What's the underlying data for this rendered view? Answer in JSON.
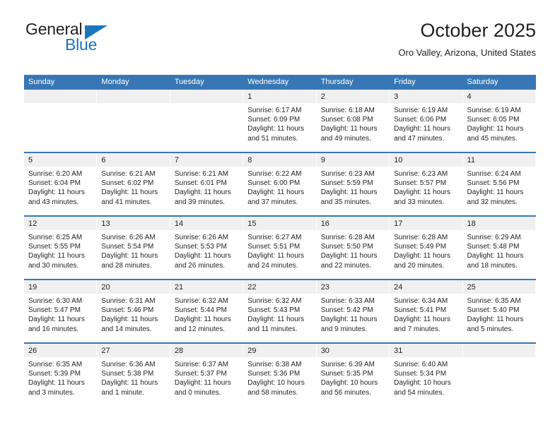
{
  "brand": {
    "name_top": "General",
    "name_bottom": "Blue",
    "logo_color": "#1b75bb",
    "triangle_icon": "triangle-icon"
  },
  "header": {
    "month_title": "October 2025",
    "location": "Oro Valley, Arizona, United States"
  },
  "theme": {
    "header_blue": "#3877b5",
    "daynum_band": "#f0f0f0",
    "text": "#231f20"
  },
  "calendar": {
    "weekday_headers": [
      "Sunday",
      "Monday",
      "Tuesday",
      "Wednesday",
      "Thursday",
      "Friday",
      "Saturday"
    ],
    "weeks": [
      [
        {
          "day": "",
          "lines": []
        },
        {
          "day": "",
          "lines": []
        },
        {
          "day": "",
          "lines": []
        },
        {
          "day": "1",
          "lines": [
            "Sunrise: 6:17 AM",
            "Sunset: 6:09 PM",
            "Daylight: 11 hours",
            "and 51 minutes."
          ]
        },
        {
          "day": "2",
          "lines": [
            "Sunrise: 6:18 AM",
            "Sunset: 6:08 PM",
            "Daylight: 11 hours",
            "and 49 minutes."
          ]
        },
        {
          "day": "3",
          "lines": [
            "Sunrise: 6:19 AM",
            "Sunset: 6:06 PM",
            "Daylight: 11 hours",
            "and 47 minutes."
          ]
        },
        {
          "day": "4",
          "lines": [
            "Sunrise: 6:19 AM",
            "Sunset: 6:05 PM",
            "Daylight: 11 hours",
            "and 45 minutes."
          ]
        }
      ],
      [
        {
          "day": "5",
          "lines": [
            "Sunrise: 6:20 AM",
            "Sunset: 6:04 PM",
            "Daylight: 11 hours",
            "and 43 minutes."
          ]
        },
        {
          "day": "6",
          "lines": [
            "Sunrise: 6:21 AM",
            "Sunset: 6:02 PM",
            "Daylight: 11 hours",
            "and 41 minutes."
          ]
        },
        {
          "day": "7",
          "lines": [
            "Sunrise: 6:21 AM",
            "Sunset: 6:01 PM",
            "Daylight: 11 hours",
            "and 39 minutes."
          ]
        },
        {
          "day": "8",
          "lines": [
            "Sunrise: 6:22 AM",
            "Sunset: 6:00 PM",
            "Daylight: 11 hours",
            "and 37 minutes."
          ]
        },
        {
          "day": "9",
          "lines": [
            "Sunrise: 6:23 AM",
            "Sunset: 5:59 PM",
            "Daylight: 11 hours",
            "and 35 minutes."
          ]
        },
        {
          "day": "10",
          "lines": [
            "Sunrise: 6:23 AM",
            "Sunset: 5:57 PM",
            "Daylight: 11 hours",
            "and 33 minutes."
          ]
        },
        {
          "day": "11",
          "lines": [
            "Sunrise: 6:24 AM",
            "Sunset: 5:56 PM",
            "Daylight: 11 hours",
            "and 32 minutes."
          ]
        }
      ],
      [
        {
          "day": "12",
          "lines": [
            "Sunrise: 6:25 AM",
            "Sunset: 5:55 PM",
            "Daylight: 11 hours",
            "and 30 minutes."
          ]
        },
        {
          "day": "13",
          "lines": [
            "Sunrise: 6:26 AM",
            "Sunset: 5:54 PM",
            "Daylight: 11 hours",
            "and 28 minutes."
          ]
        },
        {
          "day": "14",
          "lines": [
            "Sunrise: 6:26 AM",
            "Sunset: 5:53 PM",
            "Daylight: 11 hours",
            "and 26 minutes."
          ]
        },
        {
          "day": "15",
          "lines": [
            "Sunrise: 6:27 AM",
            "Sunset: 5:51 PM",
            "Daylight: 11 hours",
            "and 24 minutes."
          ]
        },
        {
          "day": "16",
          "lines": [
            "Sunrise: 6:28 AM",
            "Sunset: 5:50 PM",
            "Daylight: 11 hours",
            "and 22 minutes."
          ]
        },
        {
          "day": "17",
          "lines": [
            "Sunrise: 6:28 AM",
            "Sunset: 5:49 PM",
            "Daylight: 11 hours",
            "and 20 minutes."
          ]
        },
        {
          "day": "18",
          "lines": [
            "Sunrise: 6:29 AM",
            "Sunset: 5:48 PM",
            "Daylight: 11 hours",
            "and 18 minutes."
          ]
        }
      ],
      [
        {
          "day": "19",
          "lines": [
            "Sunrise: 6:30 AM",
            "Sunset: 5:47 PM",
            "Daylight: 11 hours",
            "and 16 minutes."
          ]
        },
        {
          "day": "20",
          "lines": [
            "Sunrise: 6:31 AM",
            "Sunset: 5:46 PM",
            "Daylight: 11 hours",
            "and 14 minutes."
          ]
        },
        {
          "day": "21",
          "lines": [
            "Sunrise: 6:32 AM",
            "Sunset: 5:44 PM",
            "Daylight: 11 hours",
            "and 12 minutes."
          ]
        },
        {
          "day": "22",
          "lines": [
            "Sunrise: 6:32 AM",
            "Sunset: 5:43 PM",
            "Daylight: 11 hours",
            "and 11 minutes."
          ]
        },
        {
          "day": "23",
          "lines": [
            "Sunrise: 6:33 AM",
            "Sunset: 5:42 PM",
            "Daylight: 11 hours",
            "and 9 minutes."
          ]
        },
        {
          "day": "24",
          "lines": [
            "Sunrise: 6:34 AM",
            "Sunset: 5:41 PM",
            "Daylight: 11 hours",
            "and 7 minutes."
          ]
        },
        {
          "day": "25",
          "lines": [
            "Sunrise: 6:35 AM",
            "Sunset: 5:40 PM",
            "Daylight: 11 hours",
            "and 5 minutes."
          ]
        }
      ],
      [
        {
          "day": "26",
          "lines": [
            "Sunrise: 6:35 AM",
            "Sunset: 5:39 PM",
            "Daylight: 11 hours",
            "and 3 minutes."
          ]
        },
        {
          "day": "27",
          "lines": [
            "Sunrise: 6:36 AM",
            "Sunset: 5:38 PM",
            "Daylight: 11 hours",
            "and 1 minute."
          ]
        },
        {
          "day": "28",
          "lines": [
            "Sunrise: 6:37 AM",
            "Sunset: 5:37 PM",
            "Daylight: 11 hours",
            "and 0 minutes."
          ]
        },
        {
          "day": "29",
          "lines": [
            "Sunrise: 6:38 AM",
            "Sunset: 5:36 PM",
            "Daylight: 10 hours",
            "and 58 minutes."
          ]
        },
        {
          "day": "30",
          "lines": [
            "Sunrise: 6:39 AM",
            "Sunset: 5:35 PM",
            "Daylight: 10 hours",
            "and 56 minutes."
          ]
        },
        {
          "day": "31",
          "lines": [
            "Sunrise: 6:40 AM",
            "Sunset: 5:34 PM",
            "Daylight: 10 hours",
            "and 54 minutes."
          ]
        },
        {
          "day": "",
          "lines": []
        }
      ]
    ]
  }
}
